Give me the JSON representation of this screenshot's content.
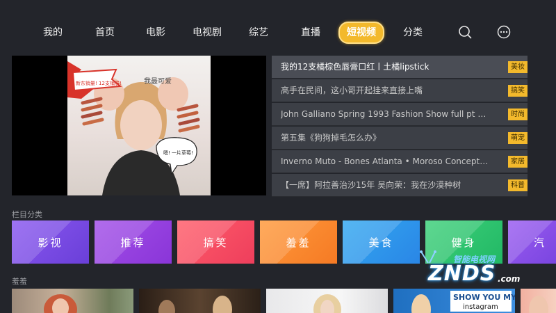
{
  "nav": {
    "items": [
      {
        "label": "我的"
      },
      {
        "label": "首页"
      },
      {
        "label": "电影"
      },
      {
        "label": "电视剧"
      },
      {
        "label": "综艺"
      },
      {
        "label": "直播"
      },
      {
        "label": "短视频"
      },
      {
        "label": "分类"
      }
    ],
    "active_index": 6,
    "search_icon": "search-icon",
    "more_icon": "more-icon"
  },
  "player": {
    "overlay_caption": "新东销量! 12支铺展!",
    "overlay_top": "我最可爱",
    "speech_bubble": "嗯! 一片草莓!"
  },
  "playlist": [
    {
      "title": "我的12支橘棕色唇膏口红丨土橘lipstick",
      "tag": "美妆"
    },
    {
      "title": "高手在民间，这小哥开起挂来直接上嘴",
      "tag": "搞笑"
    },
    {
      "title": "John Galliano Spring 1993 Fashion Show full pt 3...",
      "tag": "时尚"
    },
    {
      "title": "第五集《狗狗掉毛怎么办》",
      "tag": "萌宠"
    },
    {
      "title": "Inverno Muto - Bones Atlanta • Moroso Concept for...",
      "tag": "家居"
    },
    {
      "title": "【一席】阿拉善治沙15年 吴向荣：我在沙漠种树",
      "tag": "科普"
    }
  ],
  "sections": {
    "categories_label": "栏目分类",
    "shy_label": "羞羞"
  },
  "categories": [
    {
      "label": "影视",
      "color_a": "#8a58f0",
      "color_b": "#6a3fd8"
    },
    {
      "label": "推荐",
      "color_a": "#a24fe8",
      "color_b": "#8a35d8"
    },
    {
      "label": "搞笑",
      "color_a": "#ff5d6a",
      "color_b": "#ee3e5c"
    },
    {
      "label": "羞羞",
      "color_a": "#ff9a3c",
      "color_b": "#f57a24"
    },
    {
      "label": "美食",
      "color_a": "#33a8f0",
      "color_b": "#2a86e6"
    },
    {
      "label": "健身",
      "color_a": "#3dd07a",
      "color_b": "#22b865"
    },
    {
      "label": "汽",
      "color_a": "#9a5cf0",
      "color_b": "#7a45e0"
    }
  ],
  "thumbnails": [
    {
      "label": "thumb-1"
    },
    {
      "label": "thumb-2"
    },
    {
      "label": "thumb-3"
    },
    {
      "label": "thumb-4",
      "text": "SHOW YOU MY instagram"
    },
    {
      "label": "thumb-5"
    }
  ],
  "watermark": {
    "top": "智能电视网",
    "main": "ZNDS",
    "suffix": ".com"
  },
  "colors": {
    "accent": "#f3b92c",
    "background": "#23252b",
    "row": "#3c3f46"
  }
}
